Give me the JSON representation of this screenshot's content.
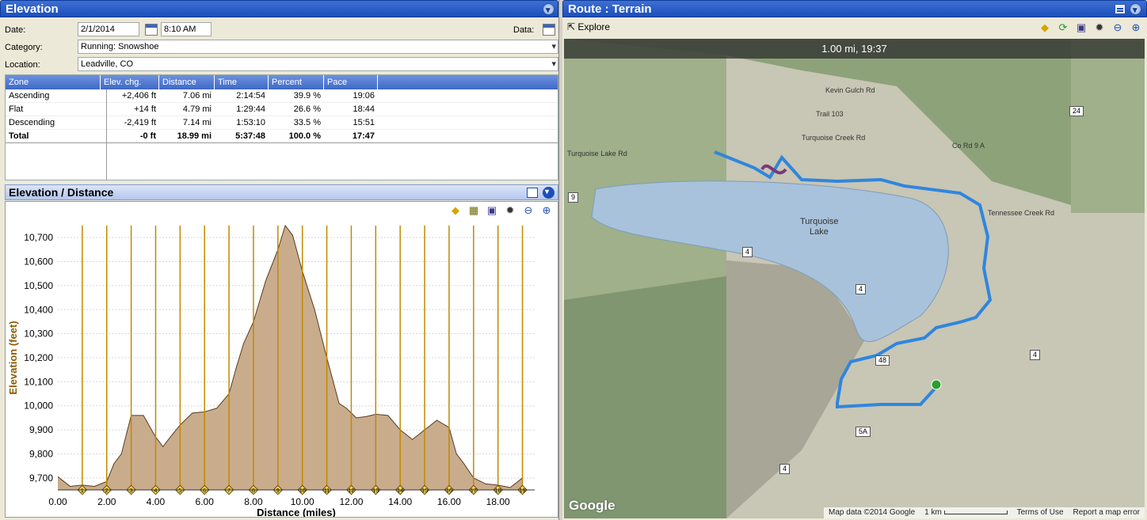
{
  "left_panel": {
    "title": "Elevation",
    "date_label": "Date:",
    "date_value": "2/1/2014",
    "time_value": "8:10 AM",
    "data_label": "Data:",
    "category_label": "Category:",
    "category_value": "Running: Snowshoe",
    "location_label": "Location:",
    "location_value": "Leadville, CO",
    "table": {
      "headers": [
        "Zone",
        "Elev. chg.",
        "Distance",
        "Time",
        "Percent",
        "Pace"
      ],
      "rows": [
        [
          "Ascending",
          "+2,406 ft",
          "7.06 mi",
          "2:14:54",
          "39.9 %",
          "19:06"
        ],
        [
          "Flat",
          "+14 ft",
          "4.79 mi",
          "1:29:44",
          "26.6 %",
          "18:44"
        ],
        [
          "Descending",
          "-2,419 ft",
          "7.14 mi",
          "1:53:10",
          "33.5 %",
          "15:51"
        ]
      ],
      "total": [
        "Total",
        "-0 ft",
        "18.99 mi",
        "5:37:48",
        "100.0 %",
        "17:47"
      ]
    }
  },
  "chart_panel": {
    "title": "Elevation / Distance"
  },
  "chart_data": {
    "type": "area",
    "xlabel": "Distance (miles)",
    "ylabel": "Elevation (feet)",
    "xlim": [
      0,
      19.5
    ],
    "ylim": [
      9650,
      10750
    ],
    "x_ticks": [
      "0.00",
      "2.00",
      "4.00",
      "6.00",
      "8.00",
      "10.00",
      "12.00",
      "14.00",
      "16.00",
      "18.00"
    ],
    "y_ticks": [
      "9,700",
      "9,800",
      "9,900",
      "10,000",
      "10,100",
      "10,200",
      "10,300",
      "10,400",
      "10,500",
      "10,600",
      "10,700"
    ],
    "mile_markers": [
      "1",
      "2",
      "3",
      "4",
      "5",
      "6",
      "7",
      "8",
      "9",
      "10",
      "11",
      "12",
      "13",
      "14",
      "15",
      "16",
      "17",
      "18",
      "19"
    ],
    "x": [
      0,
      0.5,
      1,
      1.5,
      2,
      2.3,
      2.6,
      3,
      3.5,
      4,
      4.3,
      4.6,
      5,
      5.5,
      6,
      6.5,
      7,
      7.3,
      7.6,
      8,
      8.5,
      9,
      9.3,
      9.6,
      10,
      10.5,
      11,
      11.5,
      11.8,
      12.2,
      12.6,
      13,
      13.5,
      14,
      14.5,
      15,
      15.5,
      16,
      16.3,
      16.6,
      17,
      17.5,
      18,
      18.5,
      19
    ],
    "y": [
      9705,
      9665,
      9670,
      9665,
      9685,
      9760,
      9800,
      9960,
      9960,
      9870,
      9830,
      9870,
      9920,
      9970,
      9975,
      9990,
      10050,
      10160,
      10260,
      10350,
      10520,
      10650,
      10750,
      10710,
      10560,
      10400,
      10200,
      10010,
      9990,
      9950,
      9955,
      9965,
      9960,
      9900,
      9860,
      9900,
      9940,
      9910,
      9800,
      9760,
      9700,
      9675,
      9670,
      9660,
      9700
    ],
    "grid": true,
    "fill_color": "#c9ac8c",
    "line_color": "#5a3b1f",
    "marker_line_color": "#c08a00"
  },
  "right_panel": {
    "title": "Route : Terrain",
    "explore_label": "Explore",
    "map_banner": "1.00 mi, 19:37",
    "map_labels": {
      "lake": "Turquoise",
      "lake2": "Lake",
      "road1": "Turquoise Lake Rd",
      "road2": "Co Rd 9 A",
      "road3": "Tennessee Creek Rd",
      "road4": "Kevin Gulch Rd",
      "road5": "Trail 103",
      "road6": "Turquoise Creek Rd"
    },
    "shields": [
      "9",
      "4",
      "4",
      "4",
      "5A",
      "4",
      "48",
      "24"
    ],
    "google_logo": "Google",
    "footer": {
      "map_data": "Map data ©2014 Google",
      "scale": "1 km",
      "terms": "Terms of Use",
      "report": "Report a map error"
    }
  }
}
